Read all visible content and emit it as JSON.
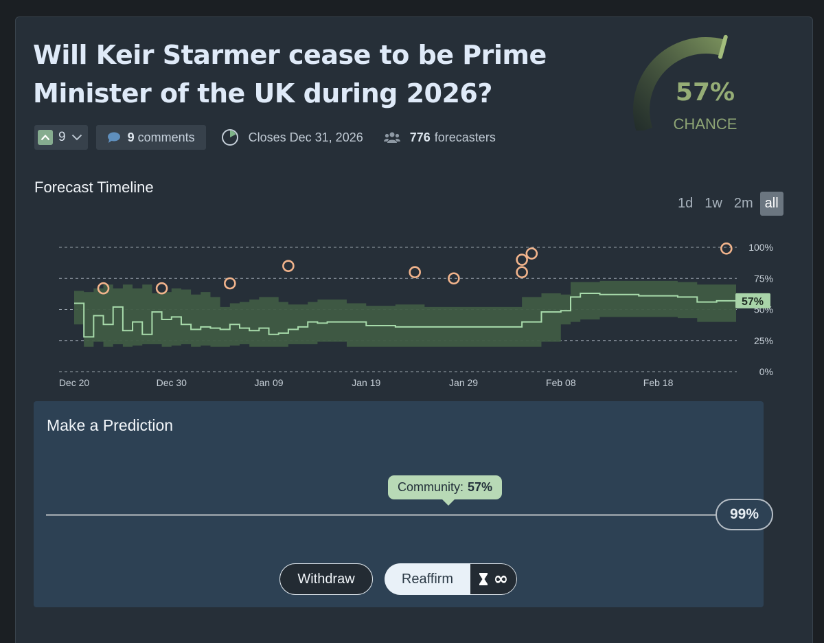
{
  "question": {
    "title": "Will Keir Starmer cease to be Prime Minister of the UK during 2026?"
  },
  "gauge": {
    "value_percent": 57,
    "value_label": "57%",
    "label": "CHANCE",
    "color": "#95ad76"
  },
  "meta": {
    "votes": "9",
    "comments_count": "9",
    "comments_label": "comments",
    "closes": "Closes Dec 31, 2026",
    "forecasters_count": "776",
    "forecasters_label": "forecasters"
  },
  "timeline": {
    "title": "Forecast Timeline",
    "ranges": [
      "1d",
      "1w",
      "2m",
      "all"
    ],
    "active_range": "all"
  },
  "chart_data": {
    "type": "line",
    "x_ticks": [
      "Dec 20",
      "Dec 30",
      "Jan 09",
      "Jan 19",
      "Jan 29",
      "Feb 08",
      "Feb 18"
    ],
    "y_ticks": [
      "0%",
      "25%",
      "50%",
      "75%",
      "100%"
    ],
    "ylim": [
      0,
      100
    ],
    "grid": true,
    "current_label": "57%",
    "series": [
      {
        "x": [
          "Dec 20",
          "Dec 21",
          "Dec 22",
          "Dec 23",
          "Dec 24",
          "Dec 25",
          "Dec 26",
          "Dec 27",
          "Dec 28",
          "Dec 29",
          "Dec 30",
          "Dec 31",
          "Jan 01",
          "Jan 02",
          "Jan 03",
          "Jan 04",
          "Jan 05",
          "Jan 06",
          "Jan 07",
          "Jan 08",
          "Jan 09",
          "Jan 10",
          "Jan 11",
          "Jan 12",
          "Jan 13",
          "Jan 14",
          "Jan 15",
          "Jan 17",
          "Jan 19",
          "Jan 22",
          "Jan 25",
          "Jan 29",
          "Feb 01",
          "Feb 03",
          "Feb 04",
          "Feb 06",
          "Feb 08",
          "Feb 09",
          "Feb 10",
          "Feb 12",
          "Feb 16",
          "Feb 20",
          "Feb 22",
          "Feb 24",
          "Feb 26"
        ],
        "values": [
          55,
          28,
          45,
          38,
          52,
          33,
          40,
          30,
          48,
          42,
          44,
          38,
          34,
          36,
          35,
          34,
          38,
          35,
          33,
          35,
          30,
          31,
          34,
          36,
          40,
          39,
          40,
          40,
          37,
          36,
          36,
          36,
          36,
          36,
          40,
          48,
          49,
          60,
          63,
          62,
          61,
          60,
          56,
          57,
          57
        ],
        "band_low": [
          38,
          20,
          24,
          20,
          22,
          20,
          21,
          22,
          22,
          20,
          21,
          22,
          20,
          21,
          20,
          20,
          21,
          22,
          20,
          20,
          20,
          20,
          22,
          22,
          22,
          24,
          24,
          20,
          20,
          20,
          20,
          20,
          20,
          20,
          20,
          24,
          38,
          40,
          42,
          44,
          44,
          43,
          40,
          40,
          40
        ],
        "band_high": [
          65,
          64,
          67,
          70,
          67,
          70,
          67,
          70,
          63,
          64,
          67,
          66,
          62,
          64,
          60,
          52,
          55,
          56,
          58,
          60,
          60,
          56,
          54,
          54,
          56,
          58,
          58,
          55,
          53,
          54,
          52,
          52,
          52,
          52,
          60,
          63,
          62,
          72,
          72,
          73,
          73,
          72,
          70,
          70,
          70
        ]
      }
    ],
    "resolution_points": [
      {
        "x": "Dec 23",
        "value": 67
      },
      {
        "x": "Dec 29",
        "value": 67
      },
      {
        "x": "Jan 05",
        "value": 71
      },
      {
        "x": "Jan 11",
        "value": 85
      },
      {
        "x": "Jan 24",
        "value": 80
      },
      {
        "x": "Jan 28",
        "value": 75
      },
      {
        "x": "Feb 04",
        "value": 80
      },
      {
        "x": "Feb 04",
        "value": 90
      },
      {
        "x": "Feb 05",
        "value": 95
      },
      {
        "x": "Feb 25",
        "value": 99
      }
    ],
    "colors": {
      "line": "#a8dbab",
      "band": "#3f5b43",
      "points": "#f2b48c"
    }
  },
  "prediction": {
    "title": "Make a Prediction",
    "community_label": "Community:",
    "community_value": "57%",
    "community_percent": 57,
    "user_value": "99%",
    "user_percent": 99,
    "withdraw_label": "Withdraw",
    "reaffirm_label": "Reaffirm",
    "infinity_symbol": "∞"
  }
}
